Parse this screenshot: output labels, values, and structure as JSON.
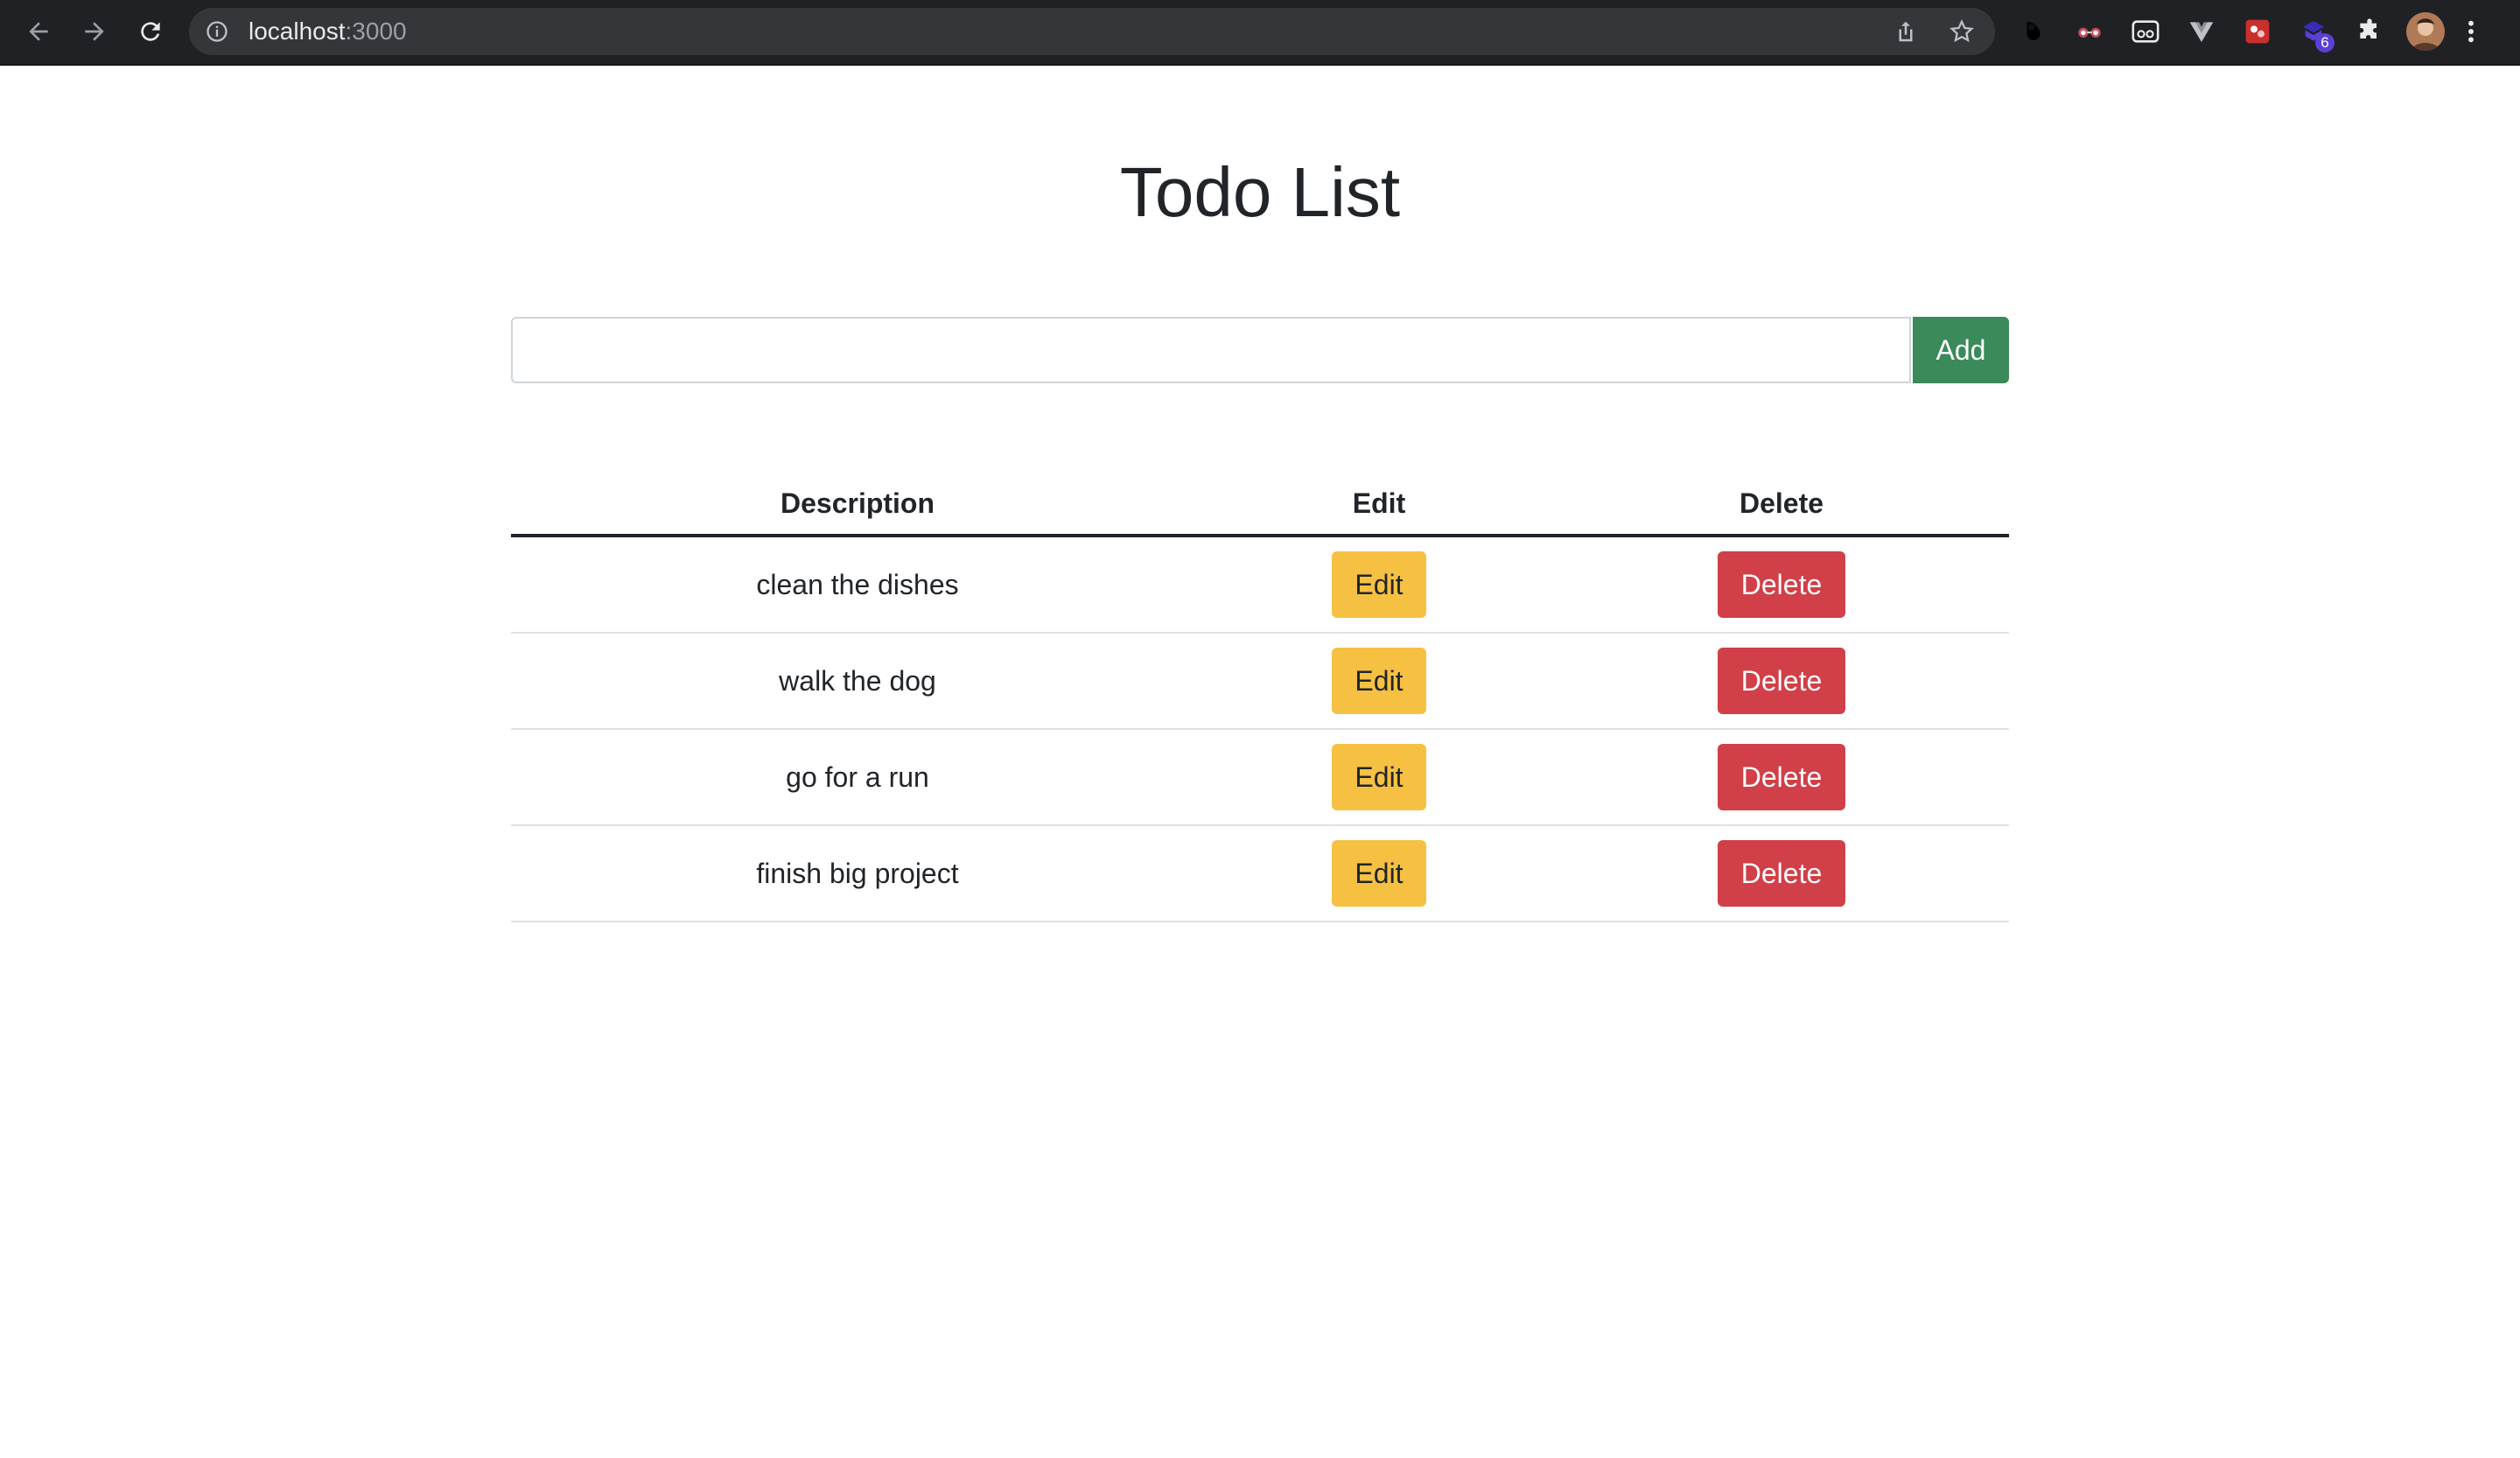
{
  "browser": {
    "url_host": "localhost",
    "url_port": ":3000",
    "extension_badge": "6"
  },
  "page": {
    "title": "Todo List"
  },
  "form": {
    "input_value": "",
    "add_label": "Add"
  },
  "table": {
    "headers": [
      "Description",
      "Edit",
      "Delete"
    ],
    "rows": [
      {
        "description": "clean the dishes",
        "edit": "Edit",
        "delete": "Delete"
      },
      {
        "description": "walk the dog",
        "edit": "Edit",
        "delete": "Delete"
      },
      {
        "description": "go for a run",
        "edit": "Edit",
        "delete": "Delete"
      },
      {
        "description": "finish big project",
        "edit": "Edit",
        "delete": "Delete"
      }
    ]
  },
  "colors": {
    "add_button": "#3b8a5a",
    "edit_button": "#f6c142",
    "delete_button": "#d13f48"
  }
}
